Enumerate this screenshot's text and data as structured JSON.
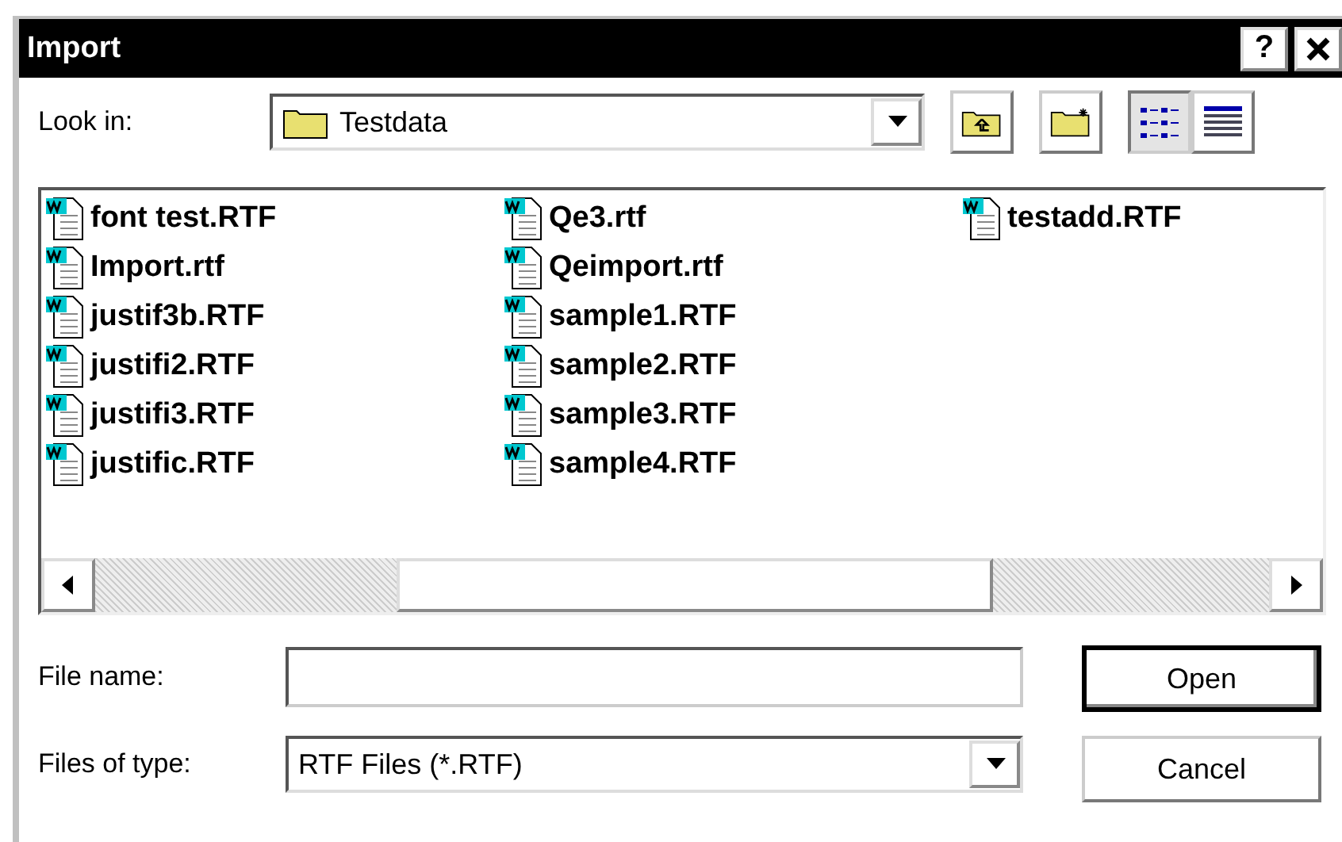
{
  "window": {
    "title": "Import",
    "help_button": "?"
  },
  "look_in": {
    "label": "Look in:",
    "value": "Testdata"
  },
  "views": [
    {
      "kind": "list",
      "selected": true
    },
    {
      "kind": "details",
      "selected": false
    }
  ],
  "files": [
    "font test.RTF",
    "Import.rtf",
    "justif3b.RTF",
    "justifi2.RTF",
    "justifi3.RTF",
    "justific.RTF",
    "Qe3.rtf",
    "Qeimport.rtf",
    "sample1.RTF",
    "sample2.RTF",
    "sample3.RTF",
    "sample4.RTF",
    "testadd.RTF"
  ],
  "file_name": {
    "label": "File name:"
  },
  "files_of_type": {
    "label": "Files of type:",
    "value": "RTF Files (*.RTF)"
  },
  "buttons": [
    {
      "label": "Open",
      "default": true
    },
    {
      "label": "Cancel",
      "default": false
    }
  ]
}
